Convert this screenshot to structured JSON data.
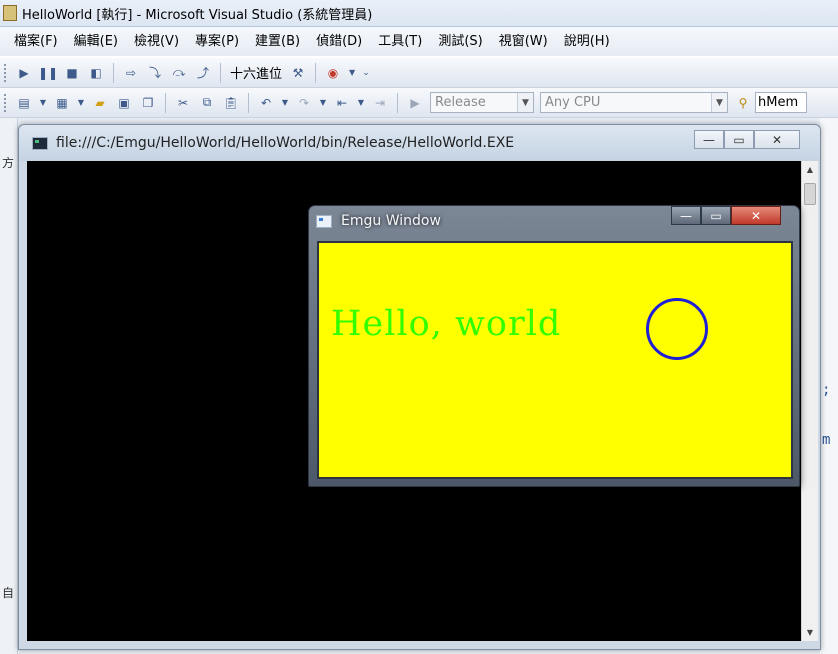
{
  "vs": {
    "title": "HelloWorld [執行] - Microsoft Visual Studio (系統管理員)",
    "menu": [
      "檔案(F)",
      "編輯(E)",
      "檢視(V)",
      "專案(P)",
      "建置(B)",
      "偵錯(D)",
      "工具(T)",
      "測試(S)",
      "視窗(W)",
      "說明(H)"
    ],
    "toolbar1": {
      "hex_label": "十六進位"
    },
    "toolbar2": {
      "configuration": "Release",
      "platform": "Any CPU",
      "find_value": "hMem"
    },
    "left_fragments": [
      "方",
      "自"
    ],
    "right_fragments": [
      ";",
      "m"
    ]
  },
  "console": {
    "title": "file:///C:/Emgu/HelloWorld/HelloWorld/bin/Release/HelloWorld.EXE",
    "background": "#000000"
  },
  "emgu": {
    "title": "Emgu Window",
    "text": "Hello, world",
    "background": "#ffff00",
    "text_color": "#33ff00",
    "circle_color": "#1f1fd6"
  },
  "icons": {
    "minimize": "minimize-icon",
    "maximize": "maximize-icon",
    "close": "close-icon"
  }
}
